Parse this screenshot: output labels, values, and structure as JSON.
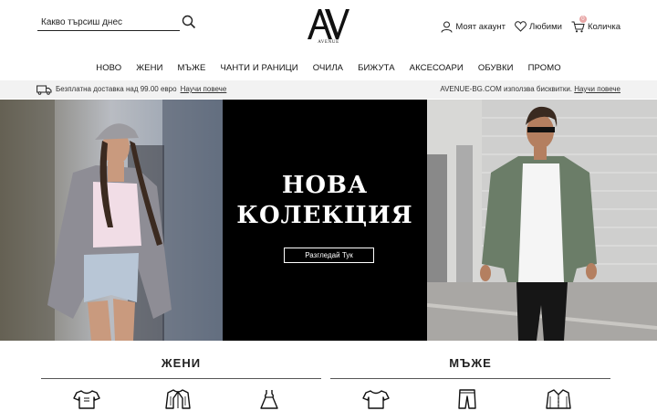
{
  "header": {
    "search_placeholder": "Какво търсиш днес",
    "logo_text": "AV",
    "logo_sub": "AVENUE",
    "account_label": "Моят акаунт",
    "favorites_label": "Любими",
    "cart_label": "Количка",
    "cart_count": "0"
  },
  "nav": {
    "items": [
      "НОВО",
      "ЖЕНИ",
      "МЪЖЕ",
      "ЧАНТИ И РАНИЦИ",
      "ОЧИЛА",
      "БИЖУТА",
      "АКСЕСОАРИ",
      "ОБУВКИ",
      "ПРОМО"
    ]
  },
  "infobar": {
    "shipping_text": "Безплатна доставка над 99.00 евро",
    "shipping_link": "Научи повече",
    "cookies_text": "AVENUE-BG.COM използва бисквитки.",
    "cookies_link": "Научи повече"
  },
  "hero": {
    "title_line1": "НОВА",
    "title_line2": "КОЛЕКЦИЯ",
    "button_label": "Разгледай Тук"
  },
  "categories": {
    "women_title": "ЖЕНИ",
    "men_title": "МЪЖЕ",
    "women_icons": [
      "tshirt-icon",
      "jacket-icon",
      "dress-icon"
    ],
    "men_icons": [
      "tshirt-icon",
      "pants-icon",
      "shirt-icon"
    ]
  },
  "colors": {
    "badge": "#e8a6a6",
    "hero_center_bg": "#000000",
    "infobar_bg": "#f2f2f2"
  }
}
